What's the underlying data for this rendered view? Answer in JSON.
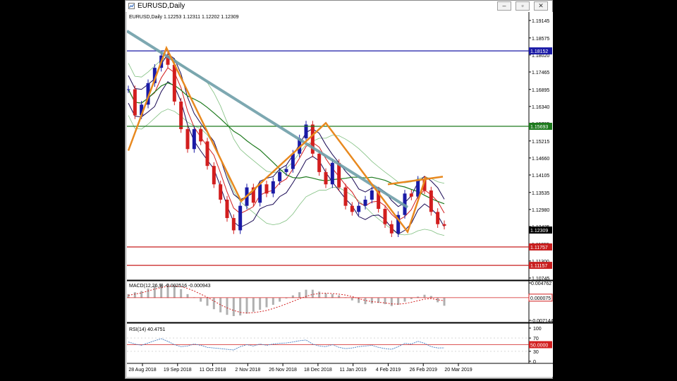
{
  "window": {
    "title": "EURUSD,Daily",
    "buttons": {
      "minimize": "–",
      "restore": "▫",
      "close": "✕"
    }
  },
  "chart_data": {
    "type": "line",
    "symbol": "EURUSD",
    "timeframe": "Daily",
    "ohlc_label": "EURUSD,Daily  1.12253 1.12311 1.12202 1.12309",
    "price_axis_ticks": [
      "1.19145",
      "1.18575",
      "1.18020",
      "1.17465",
      "1.16895",
      "1.16340",
      "1.15785",
      "1.15215",
      "1.14660",
      "1.14105",
      "1.13535",
      "1.12980",
      "1.12425",
      "1.11855",
      "1.11300",
      "1.10745"
    ],
    "ylim": [
      1.10745,
      1.19145
    ],
    "x_tick_labels": [
      "28 Aug 2018",
      "19 Sep 2018",
      "11 Oct 2018",
      "2 Nov 2018",
      "26 Nov 2018",
      "18 Dec 2018",
      "11 Jan 2019",
      "4 Feb 2019",
      "26 Feb 2019",
      "20 Mar 2019"
    ],
    "horizontal_levels": [
      {
        "price": "1.18152",
        "value": 1.18152,
        "color": "#1a1aa6"
      },
      {
        "price": "1.15693",
        "value": 1.15693,
        "color": "#1d7a1d"
      },
      {
        "price": "1.11757",
        "value": 1.11757,
        "color": "#c81e1e"
      },
      {
        "price": "1.11157",
        "value": 1.11157,
        "color": "#c81e1e"
      }
    ],
    "current_price": {
      "label": "1.12309",
      "value": 1.12309
    },
    "series": [
      {
        "name": "Close",
        "values": [
          1.169,
          1.1605,
          1.164,
          1.171,
          1.176,
          1.18,
          1.177,
          1.165,
          1.156,
          1.1495,
          1.156,
          1.152,
          1.144,
          1.138,
          1.133,
          1.127,
          1.123,
          1.131,
          1.137,
          1.132,
          1.138,
          1.135,
          1.139,
          1.142,
          1.143,
          1.148,
          1.153,
          1.1575,
          1.148,
          1.142,
          1.138,
          1.145,
          1.137,
          1.131,
          1.129,
          1.131,
          1.133,
          1.136,
          1.13,
          1.125,
          1.122,
          1.128,
          1.135,
          1.134,
          1.1395,
          1.136,
          1.129,
          1.125,
          1.1245
        ]
      }
    ],
    "zigzag": [
      1.149,
      1.1825,
      1.1325,
      1.158,
      1.1225,
      1.1405,
      1.138,
      1.1405,
      1.1405
    ],
    "trendline": [
      1.188,
      1.1305
    ],
    "indicators": {
      "macd": {
        "label": "MACD(12,26,9) -0.002516 -0.000943",
        "ticks": [
          "0.004762",
          "0.000075",
          "-0.007144"
        ],
        "ylim": [
          -0.007144,
          0.004762
        ],
        "level": 7.5e-05,
        "level_label": "0.000075",
        "histogram": [
          0.0012,
          0.0018,
          0.0022,
          0.003,
          0.0038,
          0.0044,
          0.0045,
          0.004,
          0.0028,
          0.0012,
          0.0002,
          -0.0012,
          -0.0025,
          -0.0036,
          -0.0046,
          -0.0054,
          -0.0058,
          -0.0056,
          -0.005,
          -0.0044,
          -0.0038,
          -0.003,
          -0.0022,
          -0.0012,
          -0.0002,
          0.0008,
          0.0018,
          0.0026,
          0.0026,
          0.002,
          0.0014,
          0.0012,
          0.0008,
          0.0002,
          -0.0008,
          -0.0016,
          -0.002,
          -0.0018,
          -0.0016,
          -0.002,
          -0.0026,
          -0.0022,
          -0.0012,
          -0.0004,
          0.0004,
          0.001,
          0.0006,
          -0.0014,
          -0.0025
        ],
        "signal": [
          0.0008,
          0.0012,
          0.0016,
          0.0022,
          0.0028,
          0.0033,
          0.0037,
          0.0038,
          0.0036,
          0.003,
          0.0022,
          0.0012,
          0.0002,
          -0.001,
          -0.0022,
          -0.0032,
          -0.004,
          -0.0046,
          -0.0048,
          -0.0047,
          -0.0044,
          -0.004,
          -0.0034,
          -0.0027,
          -0.0019,
          -0.0011,
          -0.0003,
          0.0005,
          0.0011,
          0.0014,
          0.0015,
          0.0014,
          0.0012,
          0.0009,
          0.0004,
          -0.0002,
          -0.0008,
          -0.0012,
          -0.0014,
          -0.0016,
          -0.0019,
          -0.002,
          -0.0018,
          -0.0014,
          -0.0009,
          -0.0004,
          -0.0002,
          -0.0006,
          -0.0009
        ]
      },
      "rsi": {
        "label": "RSI(14) 40.4751",
        "ticks": [
          "100",
          "70",
          "50.0000",
          "30",
          "0"
        ],
        "ylim": [
          0,
          100
        ],
        "level": 50,
        "level_label": "50.0000",
        "values": [
          58,
          52,
          48,
          55,
          62,
          68,
          60,
          50,
          44,
          46,
          52,
          48,
          42,
          40,
          38,
          36,
          34,
          44,
          50,
          46,
          52,
          48,
          52,
          54,
          55,
          58,
          62,
          64,
          52,
          46,
          44,
          50,
          42,
          38,
          40,
          44,
          46,
          48,
          42,
          38,
          36,
          44,
          54,
          52,
          60,
          54,
          44,
          40,
          40.5
        ]
      }
    },
    "colors": {
      "trendline": "#6f9ea8",
      "zigzag": "#e8891f",
      "bb_outer": "#7fbf7f",
      "bb_inner": "#1a0a55",
      "ma_red": "#d21e1e",
      "ma_green": "#1e7a1e",
      "bull": "#1a1aa6",
      "bear": "#d21e1e",
      "signal": "#d21e1e",
      "rsi": "#4a7fc0"
    }
  }
}
